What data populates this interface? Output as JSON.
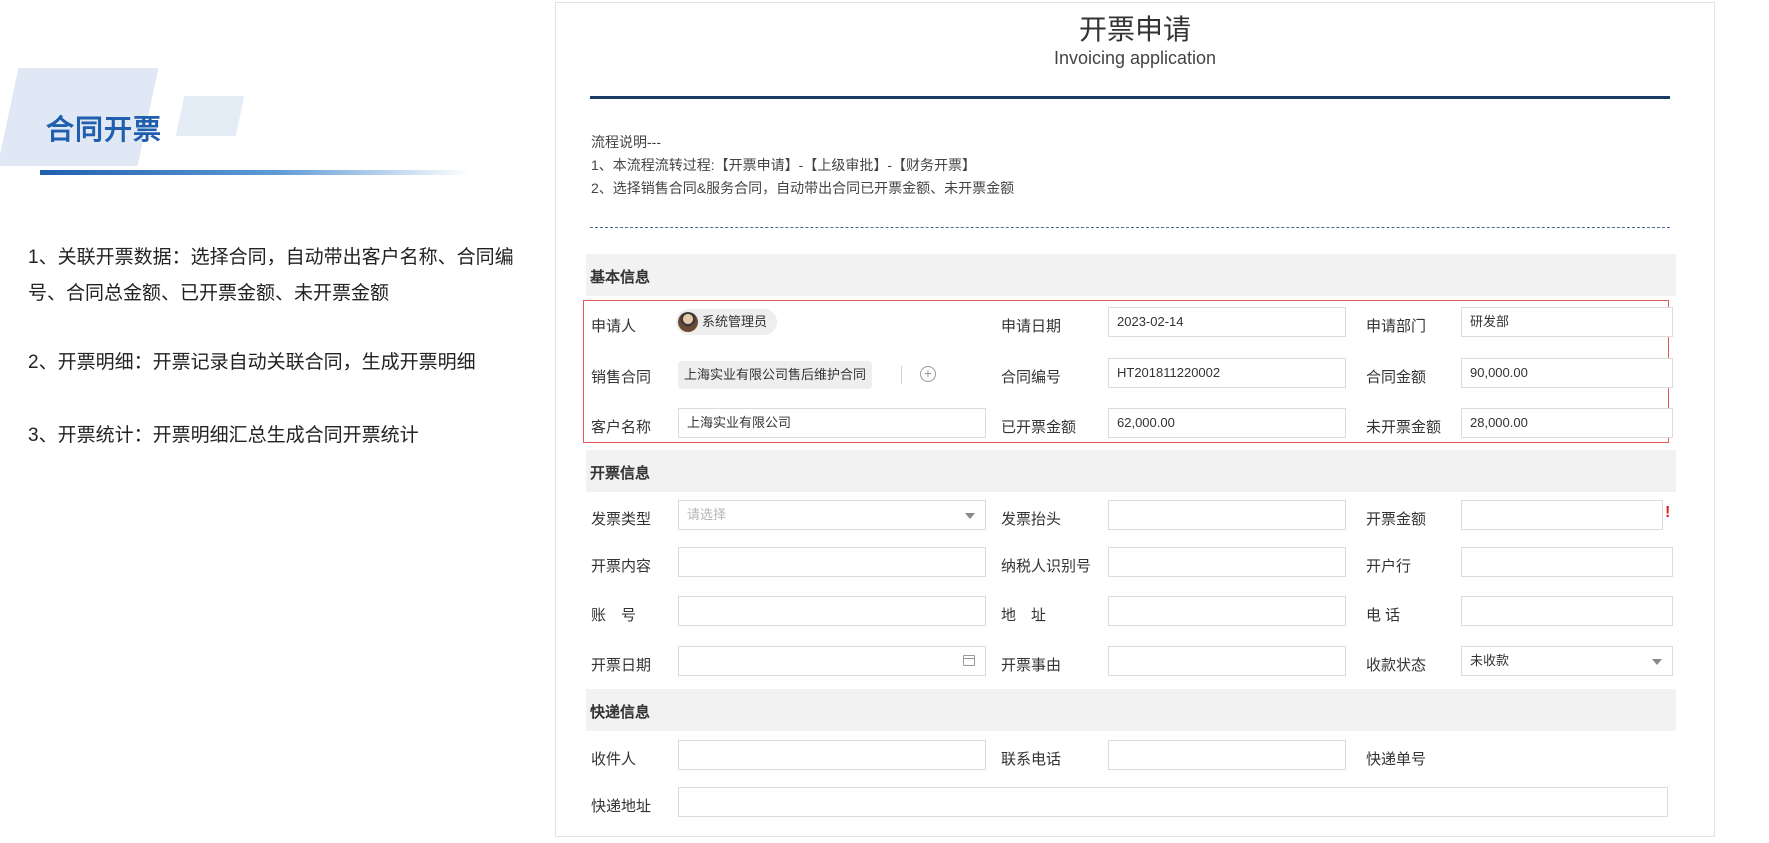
{
  "left": {
    "title": "合同开票",
    "points": [
      "1、关联开票数据：选择合同，自动带出客户名称、合同编号、合同总金额、已开票金额、未开票金额",
      "2、开票明细：开票记录自动关联合同，生成开票明细",
      "3、开票统计：开票明细汇总生成合同开票统计"
    ]
  },
  "form": {
    "title": "开票申请",
    "subtitle": "Invoicing application",
    "flow_lines": [
      "流程说明---",
      "1、本流程流转过程:【开票申请】-【上级审批】-【财务开票】",
      "2、选择销售合同&服务合同，自动带出合同已开票金额、未开票金额"
    ],
    "sections": {
      "basic": "基本信息",
      "invoice": "开票信息",
      "delivery": "快递信息"
    },
    "basic": {
      "applicant_label": "申请人",
      "applicant_value": "系统管理员",
      "apply_date_label": "申请日期",
      "apply_date_value": "2023-02-14",
      "dept_label": "申请部门",
      "dept_value": "研发部",
      "contract_label": "销售合同",
      "contract_value": "上海实业有限公司售后维护合同",
      "contract_no_label": "合同编号",
      "contract_no_value": "HT201811220002",
      "contract_amount_label": "合同金额",
      "contract_amount_value": "90,000.00",
      "customer_label": "客户名称",
      "customer_value": "上海实业有限公司",
      "invoiced_label": "已开票金额",
      "invoiced_value": "62,000.00",
      "uninvoiced_label": "未开票金额",
      "uninvoiced_value": "28,000.00"
    },
    "invoice": {
      "type_label": "发票类型",
      "type_placeholder": "请选择",
      "header_label": "发票抬头",
      "amount_label": "开票金额",
      "content_label": "开票内容",
      "tax_id_label": "纳税人识别号",
      "bank_label": "开户行",
      "account_label": "账　号",
      "address_label": "地　址",
      "phone_label": "电 话",
      "date_label": "开票日期",
      "reason_label": "开票事由",
      "collect_label": "收款状态",
      "collect_value": "未收款",
      "required_mark": "!"
    },
    "delivery": {
      "recipient_label": "收件人",
      "contact_phone_label": "联系电话",
      "tracking_label": "快递单号",
      "address_label": "快递地址"
    }
  },
  "colors": {
    "brand": "#1f5fae",
    "highlight_border": "#e45a5a",
    "title_rule": "#1c3a66",
    "required": "#e02020"
  },
  "icons": [
    "avatar",
    "plus-circle-icon",
    "chevron-down-icon",
    "calendar-icon"
  ]
}
